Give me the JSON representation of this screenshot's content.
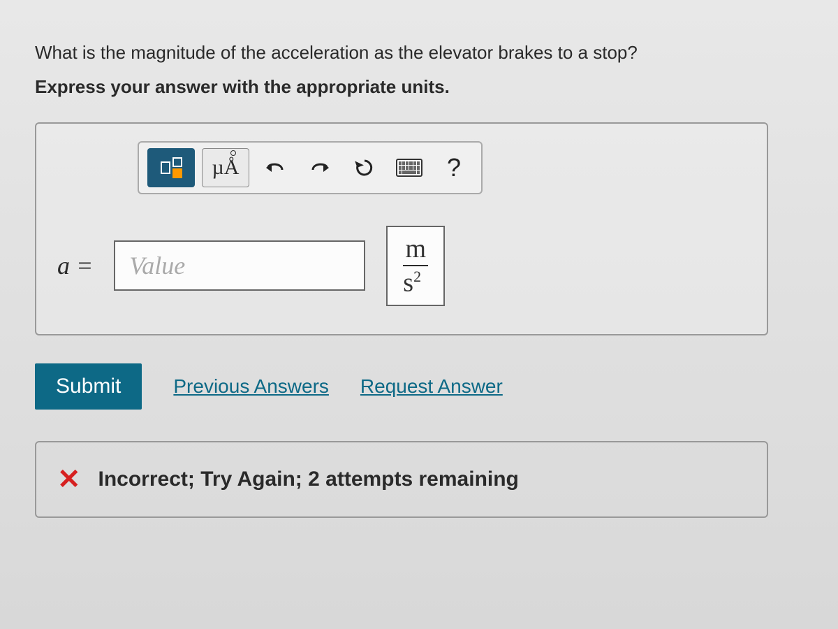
{
  "question": "What is the magnitude of the acceleration as the elevator brakes to a stop?",
  "instructions": "Express your answer with the appropriate units.",
  "toolbar": {
    "symbols_label": "µÅ",
    "help_label": "?"
  },
  "answer": {
    "var_label": "a =",
    "value_placeholder": "Value",
    "value": "",
    "unit_numerator": "m",
    "unit_denominator_base": "s",
    "unit_denominator_exp": "2"
  },
  "actions": {
    "submit": "Submit",
    "previous": "Previous Answers",
    "request": "Request Answer"
  },
  "feedback": {
    "icon": "✕",
    "message": "Incorrect; Try Again; 2 attempts remaining"
  }
}
